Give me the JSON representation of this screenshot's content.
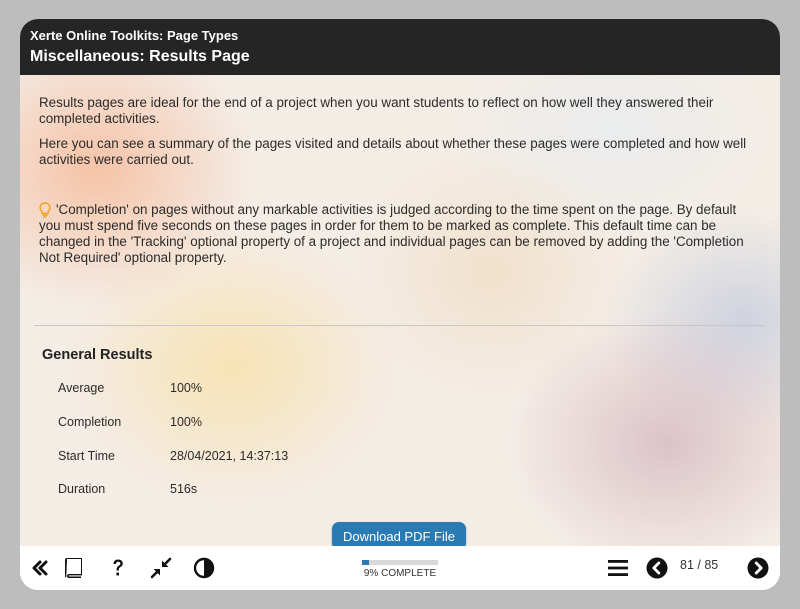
{
  "header": {
    "course_title": "Xerte Online Toolkits: Page Types",
    "page_title": "Miscellaneous: Results Page"
  },
  "intro": {
    "paragraph1": "Results pages are ideal for the end of a project when you want students to reflect on how well they answered their completed activities.",
    "paragraph2": "Here you can see a summary of the pages visited and details about whether these pages were completed and how well activities were carried out.",
    "tip": "'Completion' on pages without any markable activities is judged according to the time spent on the page. By default you must spend five seconds on these pages in order for them to be marked as complete. This default time can be changed in the 'Tracking' optional property of a project and individual pages can be removed by adding the 'Completion Not Required' optional property.",
    "tip_icon": "lightbulb-icon"
  },
  "results": {
    "title": "General Results",
    "rows": [
      {
        "label": "Average",
        "value": "100%"
      },
      {
        "label": "Completion",
        "value": "100%"
      },
      {
        "label": "Start Time",
        "value": "28/04/2021, 14:37:13"
      },
      {
        "label": "Duration",
        "value": "516s"
      }
    ],
    "download_label": "Download PDF File"
  },
  "footer": {
    "progress_label": "9% COMPLETE",
    "progress_percent": 9,
    "page_counter": "81 / 85",
    "icons": [
      "double-chevron-left-icon",
      "glossary-book-icon",
      "help-icon",
      "minimize-icon",
      "contrast-icon",
      "menu-icon",
      "previous-page-icon",
      "next-page-icon"
    ]
  },
  "colors": {
    "header_bg": "#252525",
    "accent": "#2a7bb3",
    "tip_icon": "#f0a020"
  }
}
